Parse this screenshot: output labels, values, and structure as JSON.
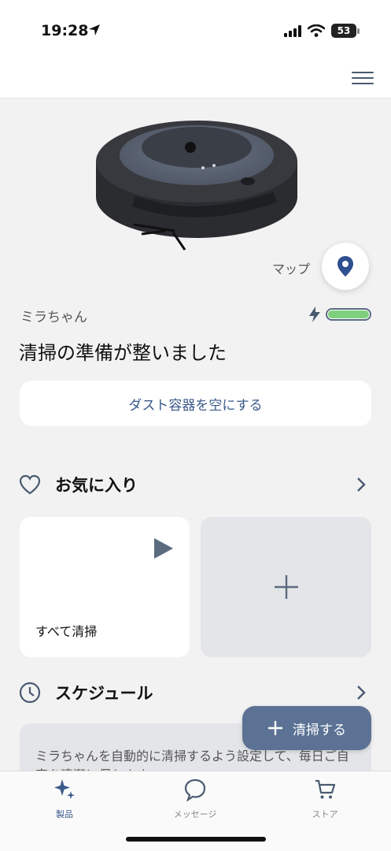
{
  "status_bar": {
    "time": "19:28",
    "battery": "53"
  },
  "map": {
    "label": "マップ"
  },
  "robot": {
    "name": "ミラちゃん",
    "status": "清掃の準備が整いました",
    "battery_level": 1.0
  },
  "actions": {
    "empty_bin": "ダスト容器を空にする"
  },
  "favorites": {
    "title": "お気に入り",
    "items": [
      {
        "label": "すべて清掃"
      }
    ]
  },
  "schedule": {
    "title": "スケジュール",
    "description": "ミラちゃんを自動的に清掃するよう設定して、毎日ご自宅を清潔に保ちます。"
  },
  "clean_button": {
    "label": "清掃する"
  },
  "tabs": [
    {
      "label": "製品",
      "icon": "sparkle-icon",
      "active": true
    },
    {
      "label": "メッセージ",
      "icon": "chat-bubble-icon",
      "active": false
    },
    {
      "label": "ストア",
      "icon": "cart-icon",
      "active": false
    }
  ],
  "colors": {
    "accent": "#3b5a8a",
    "primary_button": "#5b7294",
    "battery": "#7ed07e"
  }
}
